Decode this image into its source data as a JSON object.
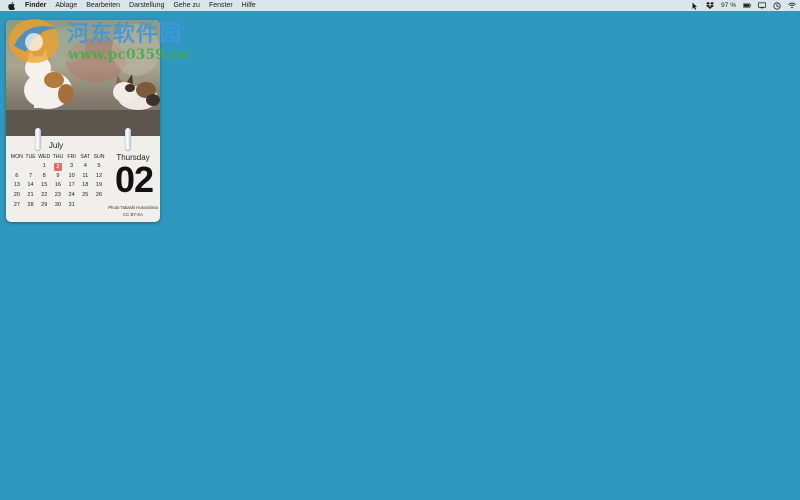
{
  "menubar": {
    "app": "Finder",
    "items": [
      "Ablage",
      "Bearbeiten",
      "Darstellung",
      "Gehe zu",
      "Fenster",
      "Hilfe"
    ],
    "status": {
      "battery_text": "97 %"
    }
  },
  "watermark": {
    "title": "河东软件园",
    "url": "www.pc0359.cn"
  },
  "calendar": {
    "month": "July",
    "weekdays": [
      "MON",
      "TUE",
      "WED",
      "THU",
      "FRI",
      "SAT",
      "SUN"
    ],
    "weeks": [
      [
        "",
        "",
        "1",
        "2",
        "3",
        "4",
        "5"
      ],
      [
        "6",
        "7",
        "8",
        "9",
        "10",
        "11",
        "12"
      ],
      [
        "13",
        "14",
        "15",
        "16",
        "17",
        "18",
        "19"
      ],
      [
        "20",
        "21",
        "22",
        "23",
        "24",
        "25",
        "26"
      ],
      [
        "27",
        "28",
        "29",
        "30",
        "31",
        "",
        ""
      ]
    ],
    "today": "2",
    "day_name": "Thursday",
    "day_number": "02",
    "credit_line1": "Photo Takashi Hososhima",
    "credit_line2": "CC BY-SA",
    "today_color": "#e46a6f"
  },
  "desktop": {
    "background_color": "#2f98bf"
  }
}
